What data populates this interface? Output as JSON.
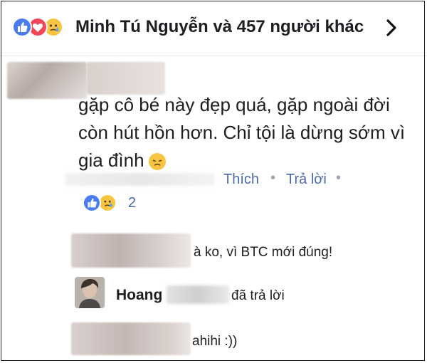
{
  "header": {
    "likes_text": "Minh Tú Nguyễn và 457 người khác",
    "reaction_icons": [
      "like-icon",
      "love-icon",
      "sad-icon"
    ]
  },
  "comment": {
    "text_line1": "gặp cô bé này đẹp quá, gặp ngoài đời",
    "text_line2": "còn hút hồn hơn. Chỉ tội là dừng sớm vì",
    "text_line3": "gia đình",
    "emoji": "disappointed-face-icon",
    "actions": {
      "like": "Thích",
      "reply": "Trả lời",
      "separator": "•"
    },
    "reaction_count": "2",
    "reaction_icons": [
      "like-icon",
      "sad-icon"
    ]
  },
  "replies": [
    {
      "text": "à ko, vì BTC mới đúng!"
    },
    {
      "name": "Hoang",
      "action": "đã trả lời"
    },
    {
      "text": "ahihi :))"
    }
  ],
  "colors": {
    "link": "#4c6aa8",
    "like_blue": "#4a7cf0",
    "love_red": "#f2475a",
    "sad_yellow": "#f7c542"
  }
}
